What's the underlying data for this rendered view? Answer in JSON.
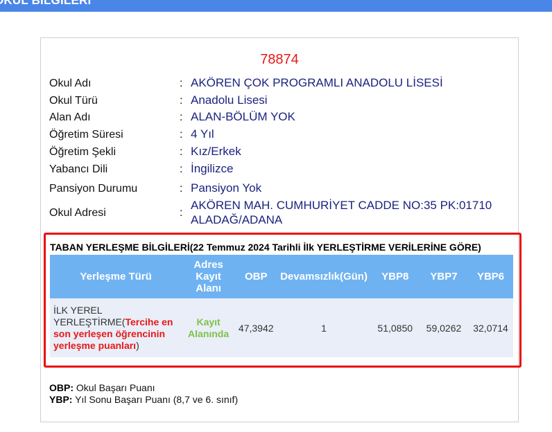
{
  "header": {
    "title": "OKUL BİLGİLERİ"
  },
  "school": {
    "code": "78874",
    "fields": [
      {
        "label": "Okul Adı",
        "value": "AKÖREN ÇOK PROGRAMLI ANADOLU LİSESİ"
      },
      {
        "label": "Okul Türü",
        "value": "Anadolu Lisesi"
      },
      {
        "label": "Alan Adı",
        "value": "ALAN-BÖLÜM YOK"
      },
      {
        "label": "Öğretim Süresi",
        "value": "4 Yıl"
      },
      {
        "label": "Öğretim Şekli",
        "value": "Kız/Erkek"
      },
      {
        "label": "Yabancı Dili",
        "value": "İngilizce"
      },
      {
        "label": "Pansiyon Durumu",
        "value": "Pansiyon Yok"
      },
      {
        "label": "Okul Adresi",
        "value": "AKÖREN MAH. CUMHURİYET CADDE NO:35 PK:01710 ALADAĞ/ADANA"
      }
    ],
    "separator": ":"
  },
  "placement": {
    "title": "TABAN YERLEŞME BİLGİLERİ(22 Temmuz 2024 Tarihli İlk YERLEŞTİRME VERİLERİNE GÖRE)",
    "columns": [
      "Yerleşme Türü",
      "Adres Kayıt Alanı",
      "OBP",
      "Devamsızlık(Gün)",
      "YBP8",
      "YBP7",
      "YBP6"
    ],
    "row": {
      "type_main": "İLK YEREL YERLEŞTİRME(",
      "type_note": "Tercihe en son yerleşen öğrencinin yerleşme puanları",
      "type_end": ")",
      "address_status": "Kayıt Alanında",
      "obp": "47,3942",
      "absence": "1",
      "ybp8": "51,0850",
      "ybp7": "59,0262",
      "ybp6": "32,0714"
    },
    "colors": {
      "border": "#ea0b0b",
      "header_bg": "#6fb2f2",
      "row_bg": "#e9eef8",
      "note": "#e81818",
      "status": "#7cc346"
    }
  },
  "legend": {
    "obp_term": "OBP:",
    "obp_text": " Okul Başarı Puanı",
    "ybp_term": "YBP:",
    "ybp_text": " Yıl Sonu Başarı Puanı (8,7 ve 6. sınıf)"
  }
}
